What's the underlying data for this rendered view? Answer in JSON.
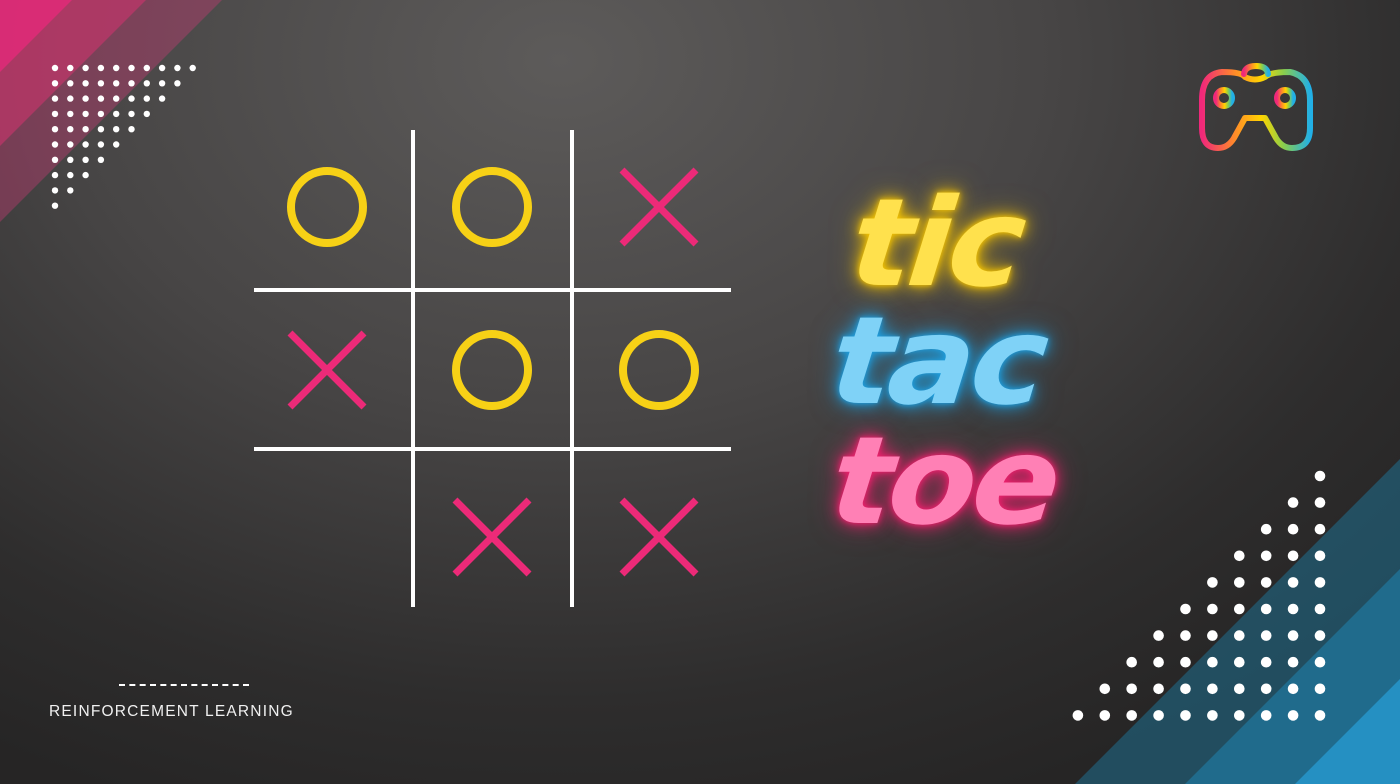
{
  "title": {
    "words": [
      "tic",
      "tac",
      "toe"
    ],
    "colors": [
      "#ffe14d",
      "#7fd2f7",
      "#ff80b5"
    ],
    "glow_colors": [
      "#f5c400",
      "#1e9fe0",
      "#f0206e"
    ]
  },
  "board": {
    "cells": [
      [
        "O",
        "O",
        "X"
      ],
      [
        "X",
        "O",
        "O"
      ],
      [
        "",
        "X",
        "X"
      ]
    ],
    "o_color": "#f7d116",
    "x_color": "#ec2a78",
    "line_color": "#ffffff"
  },
  "caption": "REINFORCEMENT LEARNING",
  "logo": {
    "icon": "gamepad-icon"
  },
  "colors": {
    "pink_accent": "#e0307a",
    "blue_accent": "#2590c2"
  }
}
